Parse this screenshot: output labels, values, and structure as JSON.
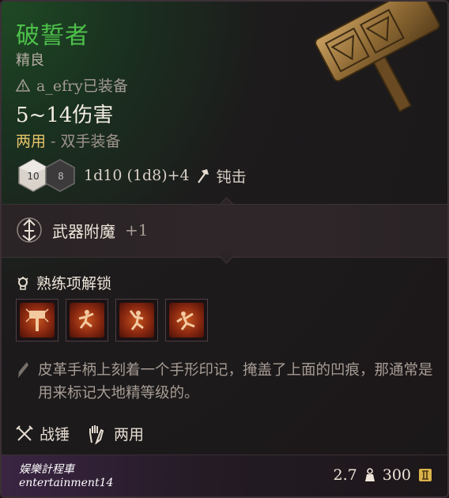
{
  "item": {
    "name": "破誓者",
    "rarity": "精良",
    "equipped_by": "a_efry已装备",
    "damage": "5~14伤害",
    "hand_label": "两用",
    "hand_sep": " - ",
    "hand_detail": "双手装备",
    "damage_formula": "1d10 (1d8)+4",
    "damage_type": "钝击",
    "dice": [
      "10",
      "8"
    ]
  },
  "enchant": {
    "label": "武器附魔",
    "bonus": "+1"
  },
  "proficiency": {
    "title": "熟练项解锁",
    "icons": [
      "hammer-icon",
      "crushing-blow-icon",
      "topple-icon",
      "lacerate-icon"
    ]
  },
  "description": "皮革手柄上刻着一个手形印记，掩盖了上面的凹痕，那通常是用来标记大地精等级的。",
  "traits": {
    "weapon_type": "战锤",
    "handedness": "两用"
  },
  "footer": {
    "watermark_line1": "娱樂計程車",
    "watermark_line2": "entertainment14",
    "weight": "2.7",
    "value": "300"
  },
  "colors": {
    "name": "#4dc04a",
    "two_handed": "#e6c56a"
  }
}
